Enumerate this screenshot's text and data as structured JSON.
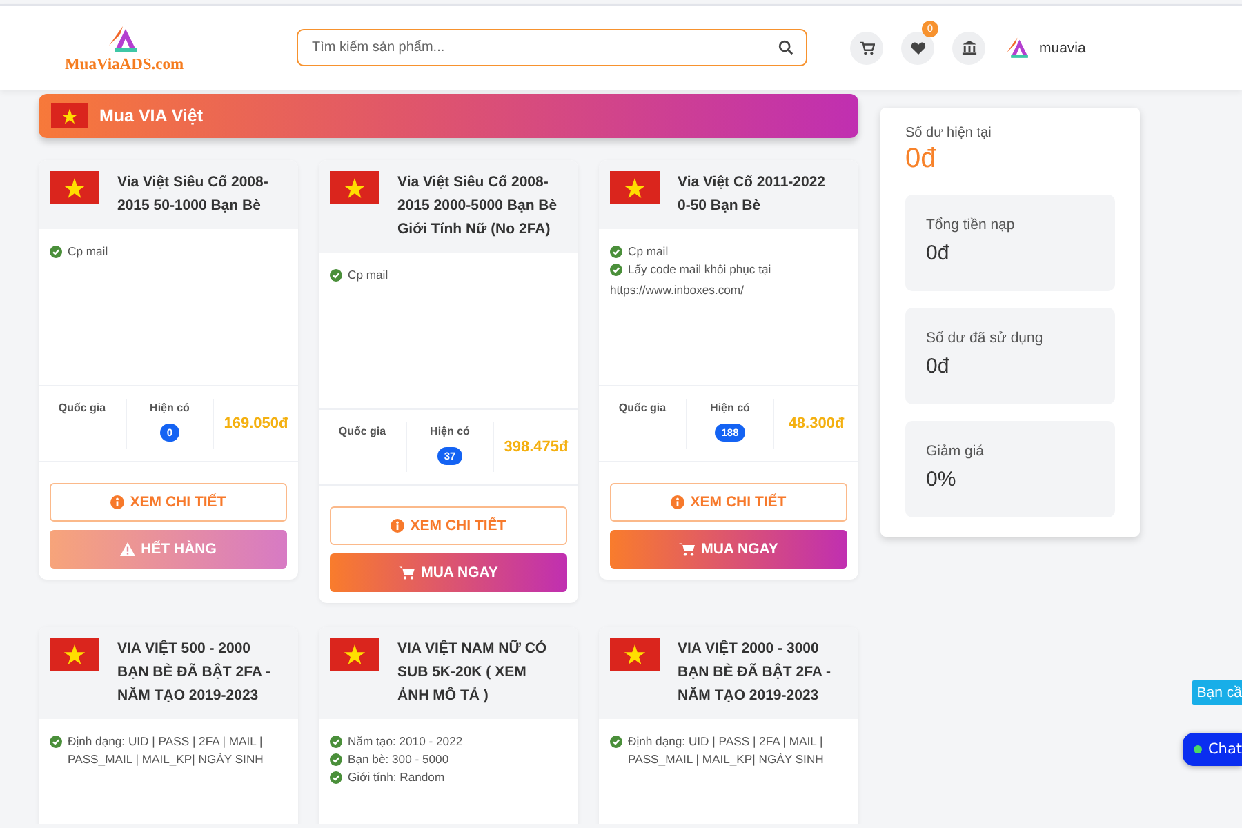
{
  "header": {
    "logo": "MuaViaADS.com",
    "search": {
      "placeholder": "Tìm kiếm sản phẩm..."
    },
    "wishlist_count": "0",
    "username": "muavia"
  },
  "category": {
    "title": "Mua VIA Việt"
  },
  "products": [
    {
      "title": "Via Việt Siêu Cổ 2008-2015 50-1000 Bạn Bè",
      "features": [
        {
          "kind": "check",
          "text": "Cp mail"
        }
      ],
      "stats": {
        "country_label": "Quốc gia",
        "stock_label": "Hiện có",
        "stock": "0",
        "price": "169.050đ"
      },
      "detail_button": "XEM CHI TIẾT",
      "action": {
        "kind": "sold_out",
        "label": "HẾT HÀNG"
      }
    },
    {
      "title": "Via Việt Siêu Cổ 2008-2015 2000-5000 Bạn Bè Giới Tính Nữ (No 2FA)",
      "features": [
        {
          "kind": "check",
          "text": "Cp mail"
        }
      ],
      "stats": {
        "country_label": "Quốc gia",
        "stock_label": "Hiện có",
        "stock": "37",
        "price": "398.475đ"
      },
      "detail_button": "XEM CHI TIẾT",
      "action": {
        "kind": "buy",
        "label": "MUA NGAY"
      }
    },
    {
      "title": "Via Việt Cổ 2011-2022 0-50 Bạn Bè",
      "features": [
        {
          "kind": "check",
          "text": "Cp mail"
        },
        {
          "kind": "check",
          "text": "Lấy code mail khôi phục tại"
        },
        {
          "kind": "text",
          "text": "https://www.inboxes.com/"
        }
      ],
      "stats": {
        "country_label": "Quốc gia",
        "stock_label": "Hiện có",
        "stock": "188",
        "price": "48.300đ"
      },
      "detail_button": "XEM CHI TIẾT",
      "action": {
        "kind": "buy",
        "label": "MUA NGAY"
      }
    },
    {
      "title": "VIA VIỆT 500 - 2000 BẠN BÈ ĐÃ BẬT 2FA - NĂM TẠO 2019-2023",
      "features": [
        {
          "kind": "check",
          "text": "Định dạng: UID | PASS | 2FA | MAIL | PASS_MAIL | MAIL_KP| NGÀY SINH"
        }
      ]
    },
    {
      "title": "VIA VIỆT NAM NỮ CÓ SUB 5K-20K ( XEM ẢNH MÔ TẢ )",
      "features": [
        {
          "kind": "check",
          "text": "Năm tạo: 2010 - 2022"
        },
        {
          "kind": "check",
          "text": "Bạn bè: 300 - 5000"
        },
        {
          "kind": "check",
          "text": "Giới tính: Random"
        }
      ]
    },
    {
      "title": "VIA VIỆT 2000 - 3000 BẠN BÈ ĐÃ BẬT 2FA - NĂM TẠO 2019-2023",
      "features": [
        {
          "kind": "check",
          "text": "Định dạng: UID | PASS | 2FA | MAIL | PASS_MAIL | MAIL_KP| NGÀY SINH"
        }
      ]
    }
  ],
  "balance": {
    "title": "Số dư hiện tại",
    "amount": "0đ",
    "stats": [
      {
        "label": "Tổng tiền nạp",
        "value": "0đ"
      },
      {
        "label": "Số dư đã sử dụng",
        "value": "0đ"
      },
      {
        "label": "Giảm giá",
        "value": "0%"
      }
    ]
  },
  "chat": {
    "prompt": "Bạn cầ",
    "button": "Chat",
    "online": true
  }
}
